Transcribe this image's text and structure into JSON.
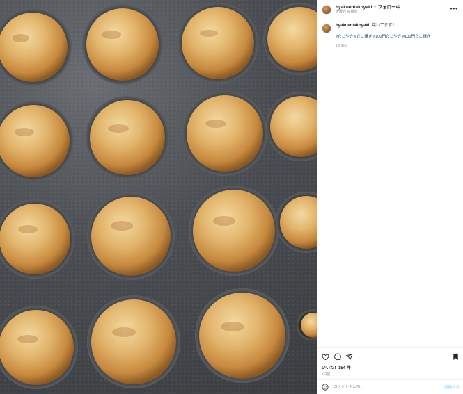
{
  "post": {
    "photo": {
      "icon": "takoyaki-pan-photo"
    },
    "header": {
      "username": "hyakuentakoyaki",
      "separator": "•",
      "follow_label": "フォロー中",
      "location": "大阪府 高槻市",
      "more_icon": "more-horizontal-icon"
    },
    "caption": {
      "username": "hyakuentakoyaki",
      "text": "焼いてます！",
      "hashtags": "#たこやき #たこ焼き #100円たこやき #100円たこ焼き",
      "time": "1週間前"
    },
    "actions": {
      "like_icon": "heart-icon",
      "comment_icon": "comment-icon",
      "share_icon": "share-icon",
      "save_icon": "bookmark-icon"
    },
    "likes": "いいね！154 件",
    "date": "7日前",
    "comment": {
      "emoji_icon": "emoji-icon",
      "placeholder": "コメントを追加...",
      "post_label": "投稿する"
    }
  }
}
